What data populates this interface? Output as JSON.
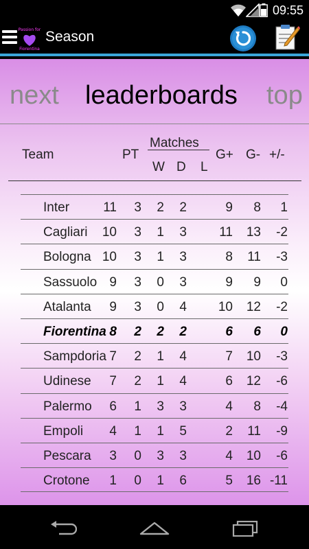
{
  "status_bar": {
    "time": "09:55"
  },
  "app_bar": {
    "logo_text_top": "Passion for",
    "logo_text_bottom": "Fiorentina",
    "title": "Season"
  },
  "tabs": {
    "prev": "next",
    "active": "leaderboards",
    "next": "top"
  },
  "table": {
    "headers": {
      "team": "Team",
      "pt": "PT",
      "matches": "Matches",
      "w": "W",
      "d": "D",
      "l": "L",
      "gf": "G+",
      "ga": "G-",
      "diff": "+/-"
    },
    "rows": [
      {
        "team": "Inter",
        "pt": "11",
        "w": "3",
        "d": "2",
        "l": "2",
        "gf": "9",
        "ga": "8",
        "diff": "1"
      },
      {
        "team": "Cagliari",
        "pt": "10",
        "w": "3",
        "d": "1",
        "l": "3",
        "gf": "11",
        "ga": "13",
        "diff": "-2"
      },
      {
        "team": "Bologna",
        "pt": "10",
        "w": "3",
        "d": "1",
        "l": "3",
        "gf": "8",
        "ga": "11",
        "diff": "-3"
      },
      {
        "team": "Sassuolo",
        "pt": "9",
        "w": "3",
        "d": "0",
        "l": "3",
        "gf": "9",
        "ga": "9",
        "diff": "0"
      },
      {
        "team": "Atalanta",
        "pt": "9",
        "w": "3",
        "d": "0",
        "l": "4",
        "gf": "10",
        "ga": "12",
        "diff": "-2"
      },
      {
        "team": "Fiorentina",
        "pt": "8",
        "w": "2",
        "d": "2",
        "l": "2",
        "gf": "6",
        "ga": "6",
        "diff": "0"
      },
      {
        "team": "Sampdoria",
        "pt": "7",
        "w": "2",
        "d": "1",
        "l": "4",
        "gf": "7",
        "ga": "10",
        "diff": "-3"
      },
      {
        "team": "Udinese",
        "pt": "7",
        "w": "2",
        "d": "1",
        "l": "4",
        "gf": "6",
        "ga": "12",
        "diff": "-6"
      },
      {
        "team": "Palermo",
        "pt": "6",
        "w": "1",
        "d": "3",
        "l": "3",
        "gf": "4",
        "ga": "8",
        "diff": "-4"
      },
      {
        "team": "Empoli",
        "pt": "4",
        "w": "1",
        "d": "1",
        "l": "5",
        "gf": "2",
        "ga": "11",
        "diff": "-9"
      },
      {
        "team": "Pescara",
        "pt": "3",
        "w": "0",
        "d": "3",
        "l": "3",
        "gf": "4",
        "ga": "10",
        "diff": "-6"
      },
      {
        "team": "Crotone",
        "pt": "1",
        "w": "0",
        "d": "1",
        "l": "6",
        "gf": "5",
        "ga": "16",
        "diff": "-11"
      }
    ]
  },
  "colors": {
    "accent": "#3aa6d8",
    "logo_pink": "#ff3cff",
    "gradient_top": "#d98ee6",
    "gradient_bottom": "#dd94ea"
  },
  "icons": [
    "wifi-icon",
    "signal-icon",
    "battery-icon",
    "menu-icon",
    "heart-icon",
    "refresh-icon",
    "notes-icon",
    "back-icon",
    "home-icon",
    "recents-icon"
  ]
}
